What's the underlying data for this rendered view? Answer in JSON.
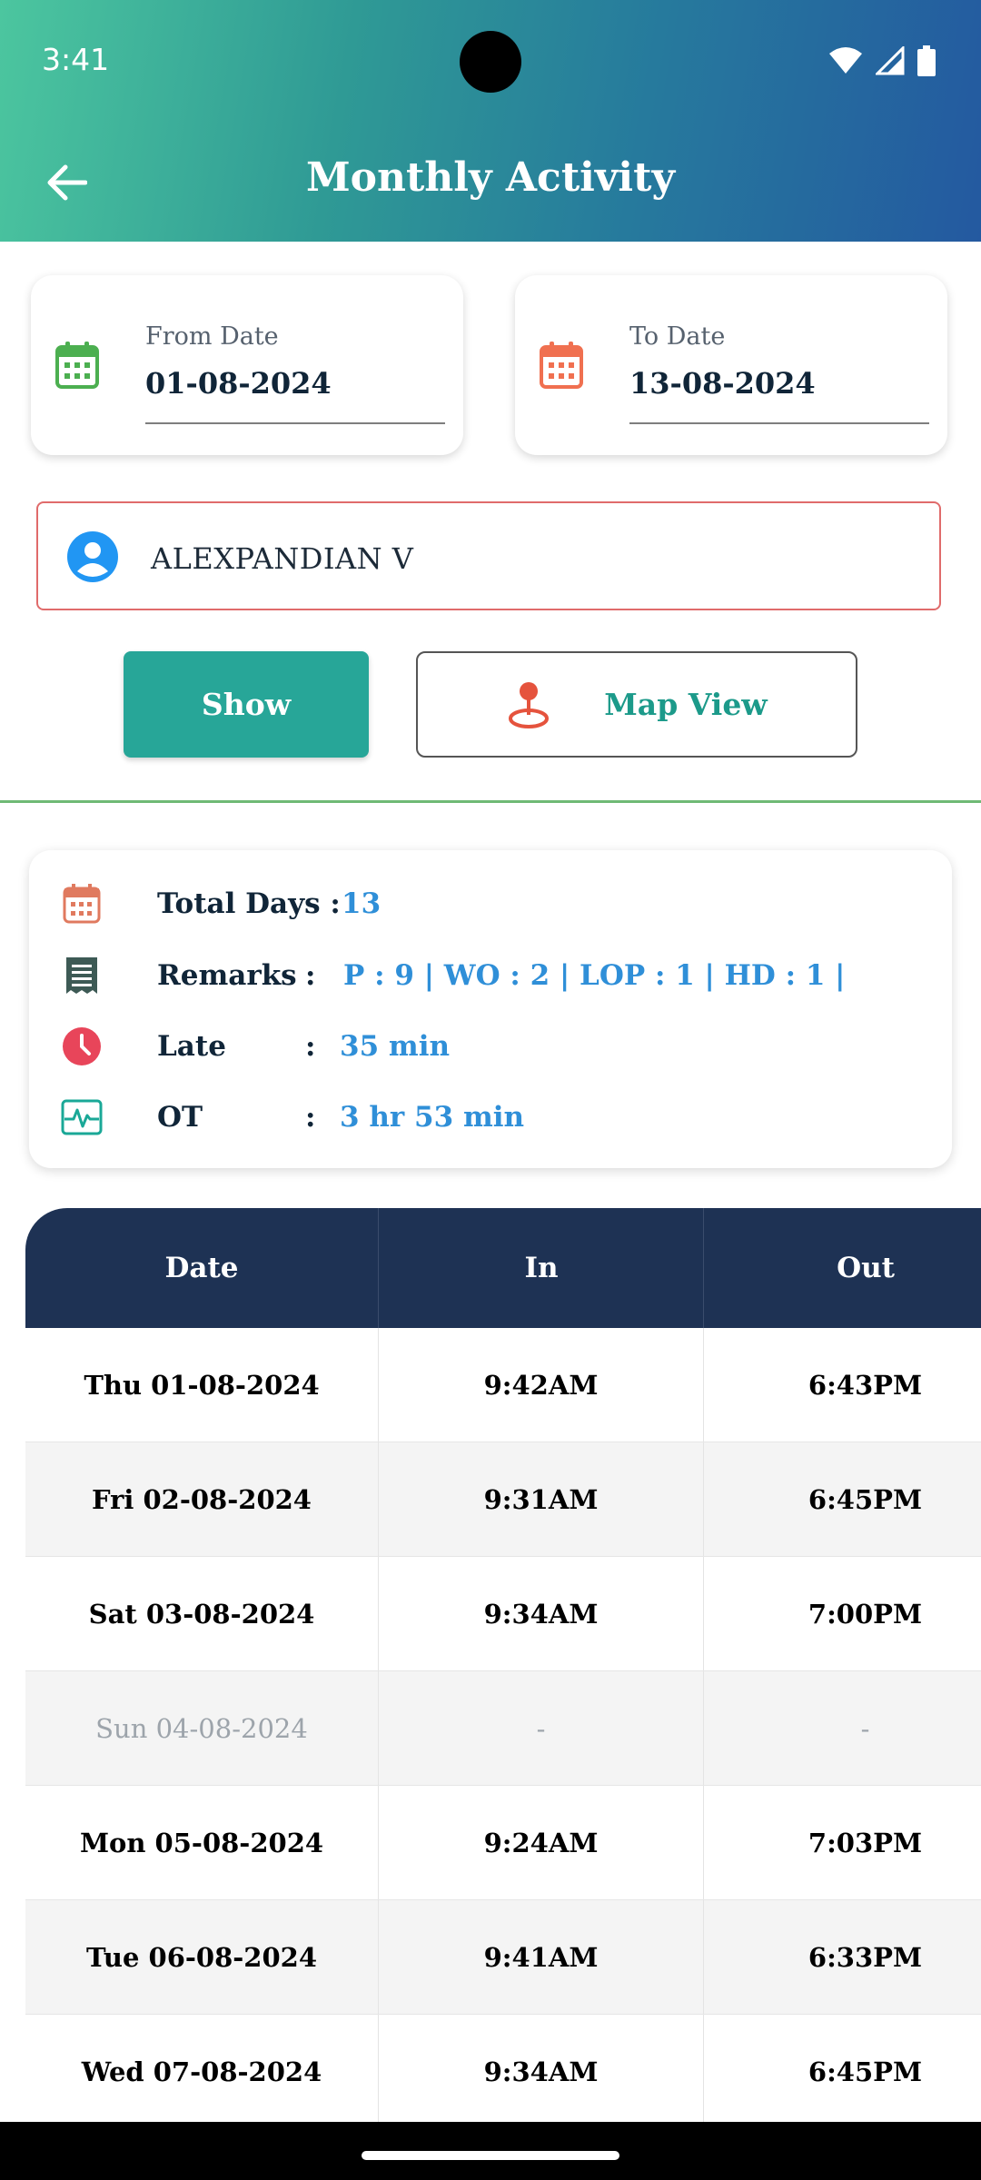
{
  "status_bar": {
    "time": "3:41"
  },
  "header": {
    "title": "Monthly Activity"
  },
  "filters": {
    "from_label": "From Date",
    "from_value": "01-08-2024",
    "to_label": "To Date",
    "to_value": "13-08-2024",
    "employee_name": "ALEXPANDIAN V"
  },
  "actions": {
    "show_label": "Show",
    "map_label": "Map View"
  },
  "summary": {
    "total_days_label": "Total Days :",
    "total_days_value": "13",
    "remarks_label": "Remarks",
    "remarks_value": "P : 9 | WO : 2 | LOP : 1 | HD : 1 |",
    "late_label": "Late",
    "late_value": "35 min",
    "ot_label": "OT",
    "ot_value": "3 hr 53 min",
    "colon": ":"
  },
  "table": {
    "headers": [
      "Date",
      "In",
      "Out"
    ],
    "rows": [
      {
        "date": "Thu 01-08-2024",
        "in": "9:42AM",
        "out": "6:43PM"
      },
      {
        "date": "Fri 02-08-2024",
        "in": "9:31AM",
        "out": "6:45PM"
      },
      {
        "date": "Sat 03-08-2024",
        "in": "9:34AM",
        "out": "7:00PM"
      },
      {
        "date": "Sun 04-08-2024",
        "in": "-",
        "out": "-"
      },
      {
        "date": "Mon 05-08-2024",
        "in": "9:24AM",
        "out": "7:03PM"
      },
      {
        "date": "Tue 06-08-2024",
        "in": "9:41AM",
        "out": "6:33PM"
      },
      {
        "date": "Wed 07-08-2024",
        "in": "9:34AM",
        "out": "6:45PM"
      }
    ]
  },
  "colors": {
    "header_start": "#4cc69f",
    "header_end": "#2459a0",
    "show_button": "#27a698",
    "table_header": "#1e3254",
    "value_blue": "#2f8fd8",
    "from_calendar": "#4caf50",
    "to_calendar": "#f07050"
  },
  "icons": {
    "back": "arrow-left-icon",
    "from": "calendar-icon",
    "to": "calendar-icon",
    "user": "person-circle-icon",
    "map": "map-pin-icon",
    "total_days": "calendar-icon",
    "remarks": "receipt-icon",
    "late": "clock-icon",
    "ot": "pulse-icon"
  }
}
